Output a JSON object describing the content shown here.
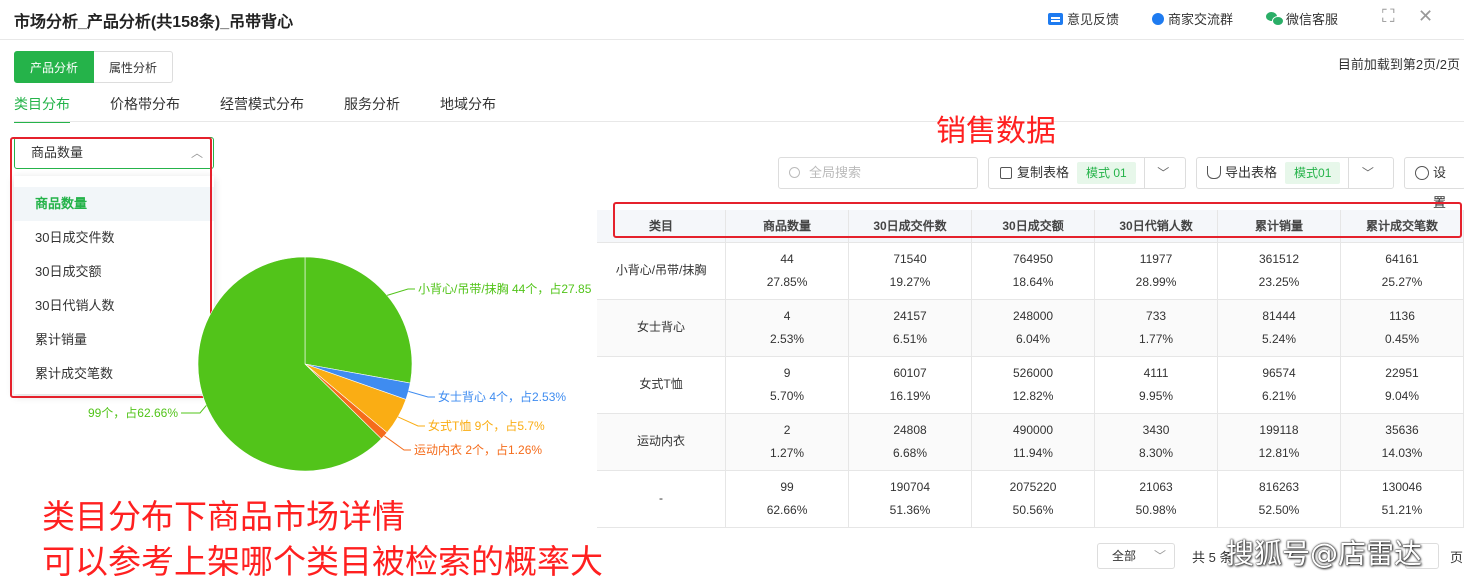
{
  "header": {
    "title": "市场分析_产品分析(共158条)_吊带背心",
    "links": [
      "意见反馈",
      "商家交流群",
      "微信客服"
    ],
    "expand": "⛶",
    "close": "✕"
  },
  "toggle": {
    "active": "产品分析",
    "inactive": "属性分析"
  },
  "page_info": "目前加载到第2页/2页",
  "tabs": [
    "类目分布",
    "价格带分布",
    "经营模式分布",
    "服务分析",
    "地域分布"
  ],
  "metric_select": {
    "value": "商品数量",
    "options": [
      "商品数量",
      "30日成交件数",
      "30日成交额",
      "30日代销人数",
      "累计销量",
      "累计成交笔数"
    ]
  },
  "annotations": {
    "sales": "销售数据",
    "line1": "类目分布下商品市场详情",
    "line2": "可以参考上架哪个类目被检索的概率大"
  },
  "toolbar": {
    "search_placeholder": "全局搜索",
    "copy_label": "复制表格",
    "copy_mode": "模式 01",
    "export_label": "导出表格",
    "export_mode": "模式01",
    "settings_label": "设置"
  },
  "chart_data": {
    "type": "pie",
    "slices": [
      {
        "label": "小背心/吊带/抹胸 44个，占27.85",
        "value": 27.85,
        "color": "#52c41a"
      },
      {
        "label": "女士背心 4个，占2.53%",
        "value": 2.53,
        "color": "#3f8cf0"
      },
      {
        "label": "女式T恤 9个，占5.7%",
        "value": 5.7,
        "color": "#faad14"
      },
      {
        "label": "运动内衣 2个，占1.26%",
        "value": 1.26,
        "color": "#f56c1b"
      },
      {
        "label": "99个，占62.66%",
        "value": 62.66,
        "color": "#52c41a"
      }
    ]
  },
  "table": {
    "headers": [
      "类目",
      "商品数量",
      "30日成交件数",
      "30日成交额",
      "30日代销人数",
      "累计销量",
      "累计成交笔数"
    ],
    "rows": [
      [
        "小背心/吊带/抹胸",
        [
          "44",
          "27.85%"
        ],
        [
          "71540",
          "19.27%"
        ],
        [
          "764950",
          "18.64%"
        ],
        [
          "11977",
          "28.99%"
        ],
        [
          "361512",
          "23.25%"
        ],
        [
          "64161",
          "25.27%"
        ]
      ],
      [
        "女士背心",
        [
          "4",
          "2.53%"
        ],
        [
          "24157",
          "6.51%"
        ],
        [
          "248000",
          "6.04%"
        ],
        [
          "733",
          "1.77%"
        ],
        [
          "81444",
          "5.24%"
        ],
        [
          "1136",
          "0.45%"
        ]
      ],
      [
        "女式T恤",
        [
          "9",
          "5.70%"
        ],
        [
          "60107",
          "16.19%"
        ],
        [
          "526000",
          "12.82%"
        ],
        [
          "4111",
          "9.95%"
        ],
        [
          "96574",
          "6.21%"
        ],
        [
          "22951",
          "9.04%"
        ]
      ],
      [
        "运动内衣",
        [
          "2",
          "1.27%"
        ],
        [
          "24808",
          "6.68%"
        ],
        [
          "490000",
          "11.94%"
        ],
        [
          "3430",
          "8.30%"
        ],
        [
          "199118",
          "12.81%"
        ],
        [
          "35636",
          "14.03%"
        ]
      ],
      [
        "-",
        [
          "99",
          "62.66%"
        ],
        [
          "190704",
          "51.36%"
        ],
        [
          "2075220",
          "50.56%"
        ],
        [
          "21063",
          "50.98%"
        ],
        [
          "816263",
          "52.50%"
        ],
        [
          "130046",
          "51.21%"
        ]
      ]
    ]
  },
  "footer": {
    "page_size": "全部",
    "total": "共 5 条",
    "last": "页",
    "watermark": "搜狐号@店雷达"
  }
}
